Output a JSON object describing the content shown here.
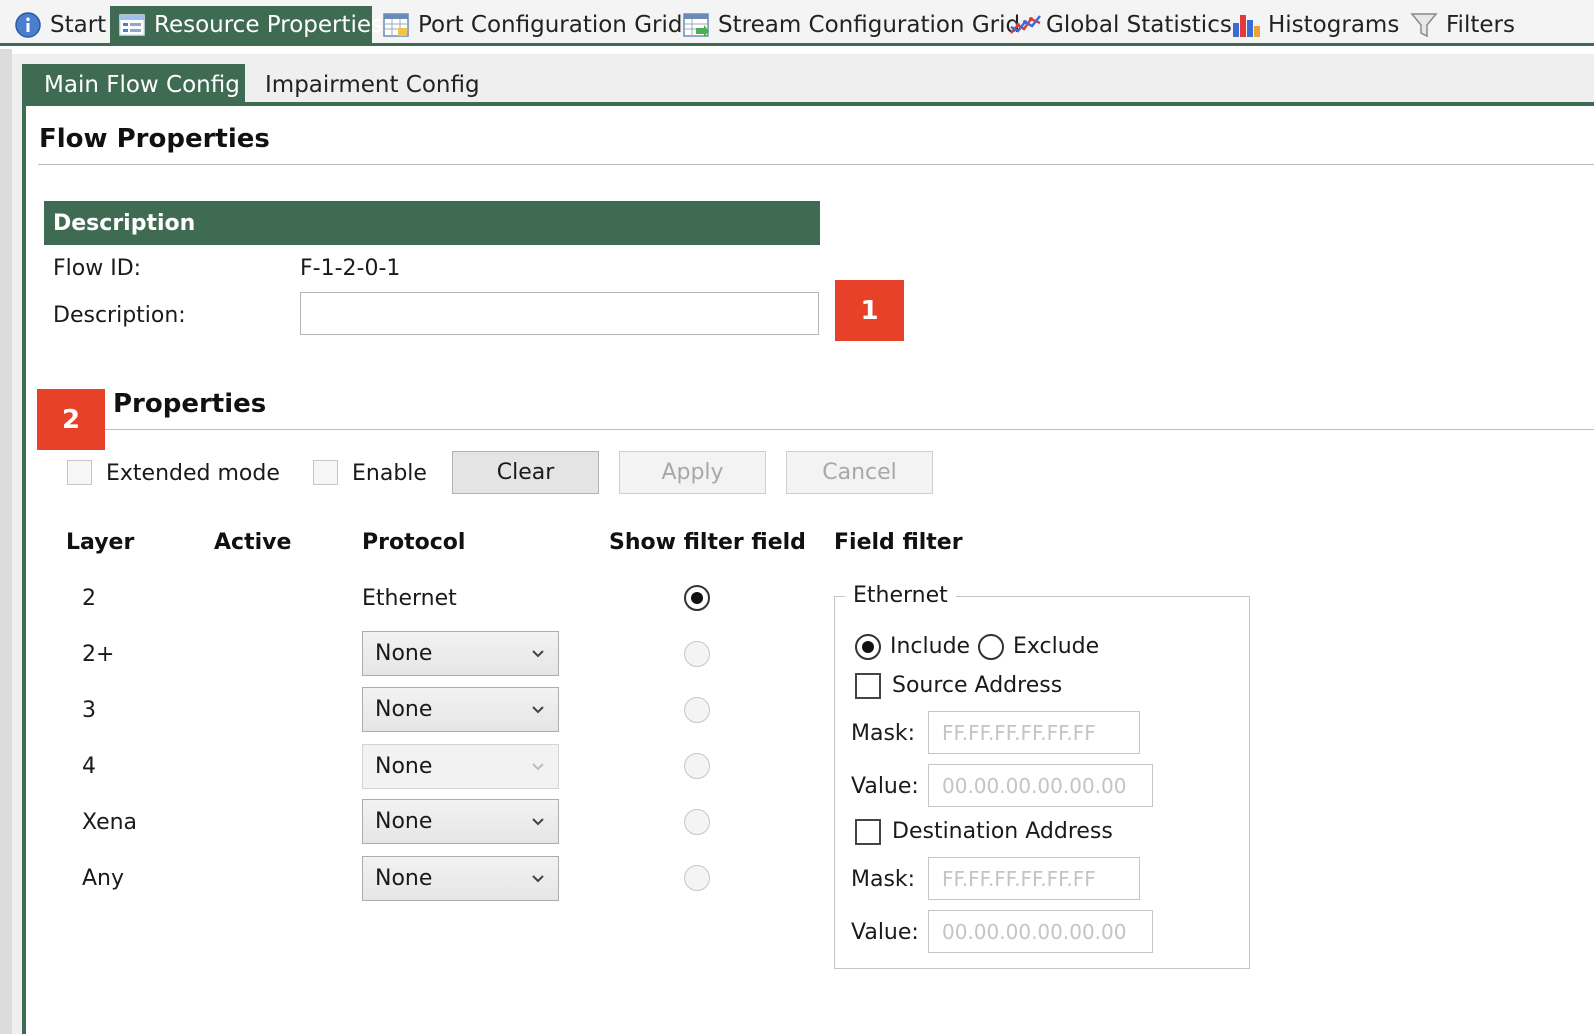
{
  "top_tabs": [
    {
      "label": "Start",
      "icon": "info-icon"
    },
    {
      "label": "Resource Properties",
      "icon": "properties-icon"
    },
    {
      "label": "Port Configuration Grid",
      "icon": "grid-icon"
    },
    {
      "label": "Stream Configuration Grid",
      "icon": "grid-arrow-icon"
    },
    {
      "label": "Global Statistics",
      "icon": "line-chart-icon"
    },
    {
      "label": "Histograms",
      "icon": "bar-chart-icon"
    },
    {
      "label": "Filters",
      "icon": "funnel-icon"
    }
  ],
  "sub_tabs": [
    "Main Flow Config",
    "Impairment Config"
  ],
  "flow_properties": {
    "title": "Flow Properties"
  },
  "description": {
    "header": "Description",
    "flow_id_label": "Flow ID:",
    "flow_id_value": "F-1-2-0-1",
    "description_label": "Description:",
    "description_value": ""
  },
  "badges": [
    "1",
    "2"
  ],
  "properties": {
    "title": "Properties",
    "extended_mode_label": "Extended mode",
    "enable_label": "Enable",
    "clear_label": "Clear",
    "apply_label": "Apply",
    "cancel_label": "Cancel"
  },
  "table": {
    "headers": [
      "Layer",
      "Active",
      "Protocol",
      "Show filter field",
      "Field filter"
    ],
    "rows": [
      {
        "layer": "2",
        "protocol": "Ethernet"
      },
      {
        "layer": "2+",
        "protocol": "None"
      },
      {
        "layer": "3",
        "protocol": "None"
      },
      {
        "layer": "4",
        "protocol": "None"
      },
      {
        "layer": "Xena",
        "protocol": "None"
      },
      {
        "layer": "Any",
        "protocol": "None"
      }
    ]
  },
  "field_filter": {
    "group_title": "Ethernet",
    "include_label": "Include",
    "exclude_label": "Exclude",
    "source_address_label": "Source Address",
    "destination_address_label": "Destination Address",
    "mask_label": "Mask:",
    "value_label": "Value:",
    "src_mask_placeholder": "FF.FF.FF.FF.FF.FF",
    "src_value_placeholder": "00.00.00.00.00.00",
    "dst_mask_placeholder": "FF.FF.FF.FF.FF.FF",
    "dst_value_placeholder": "00.00.00.00.00.00"
  },
  "colors": {
    "accent": "#3f6b52",
    "badge": "#e8412a"
  }
}
